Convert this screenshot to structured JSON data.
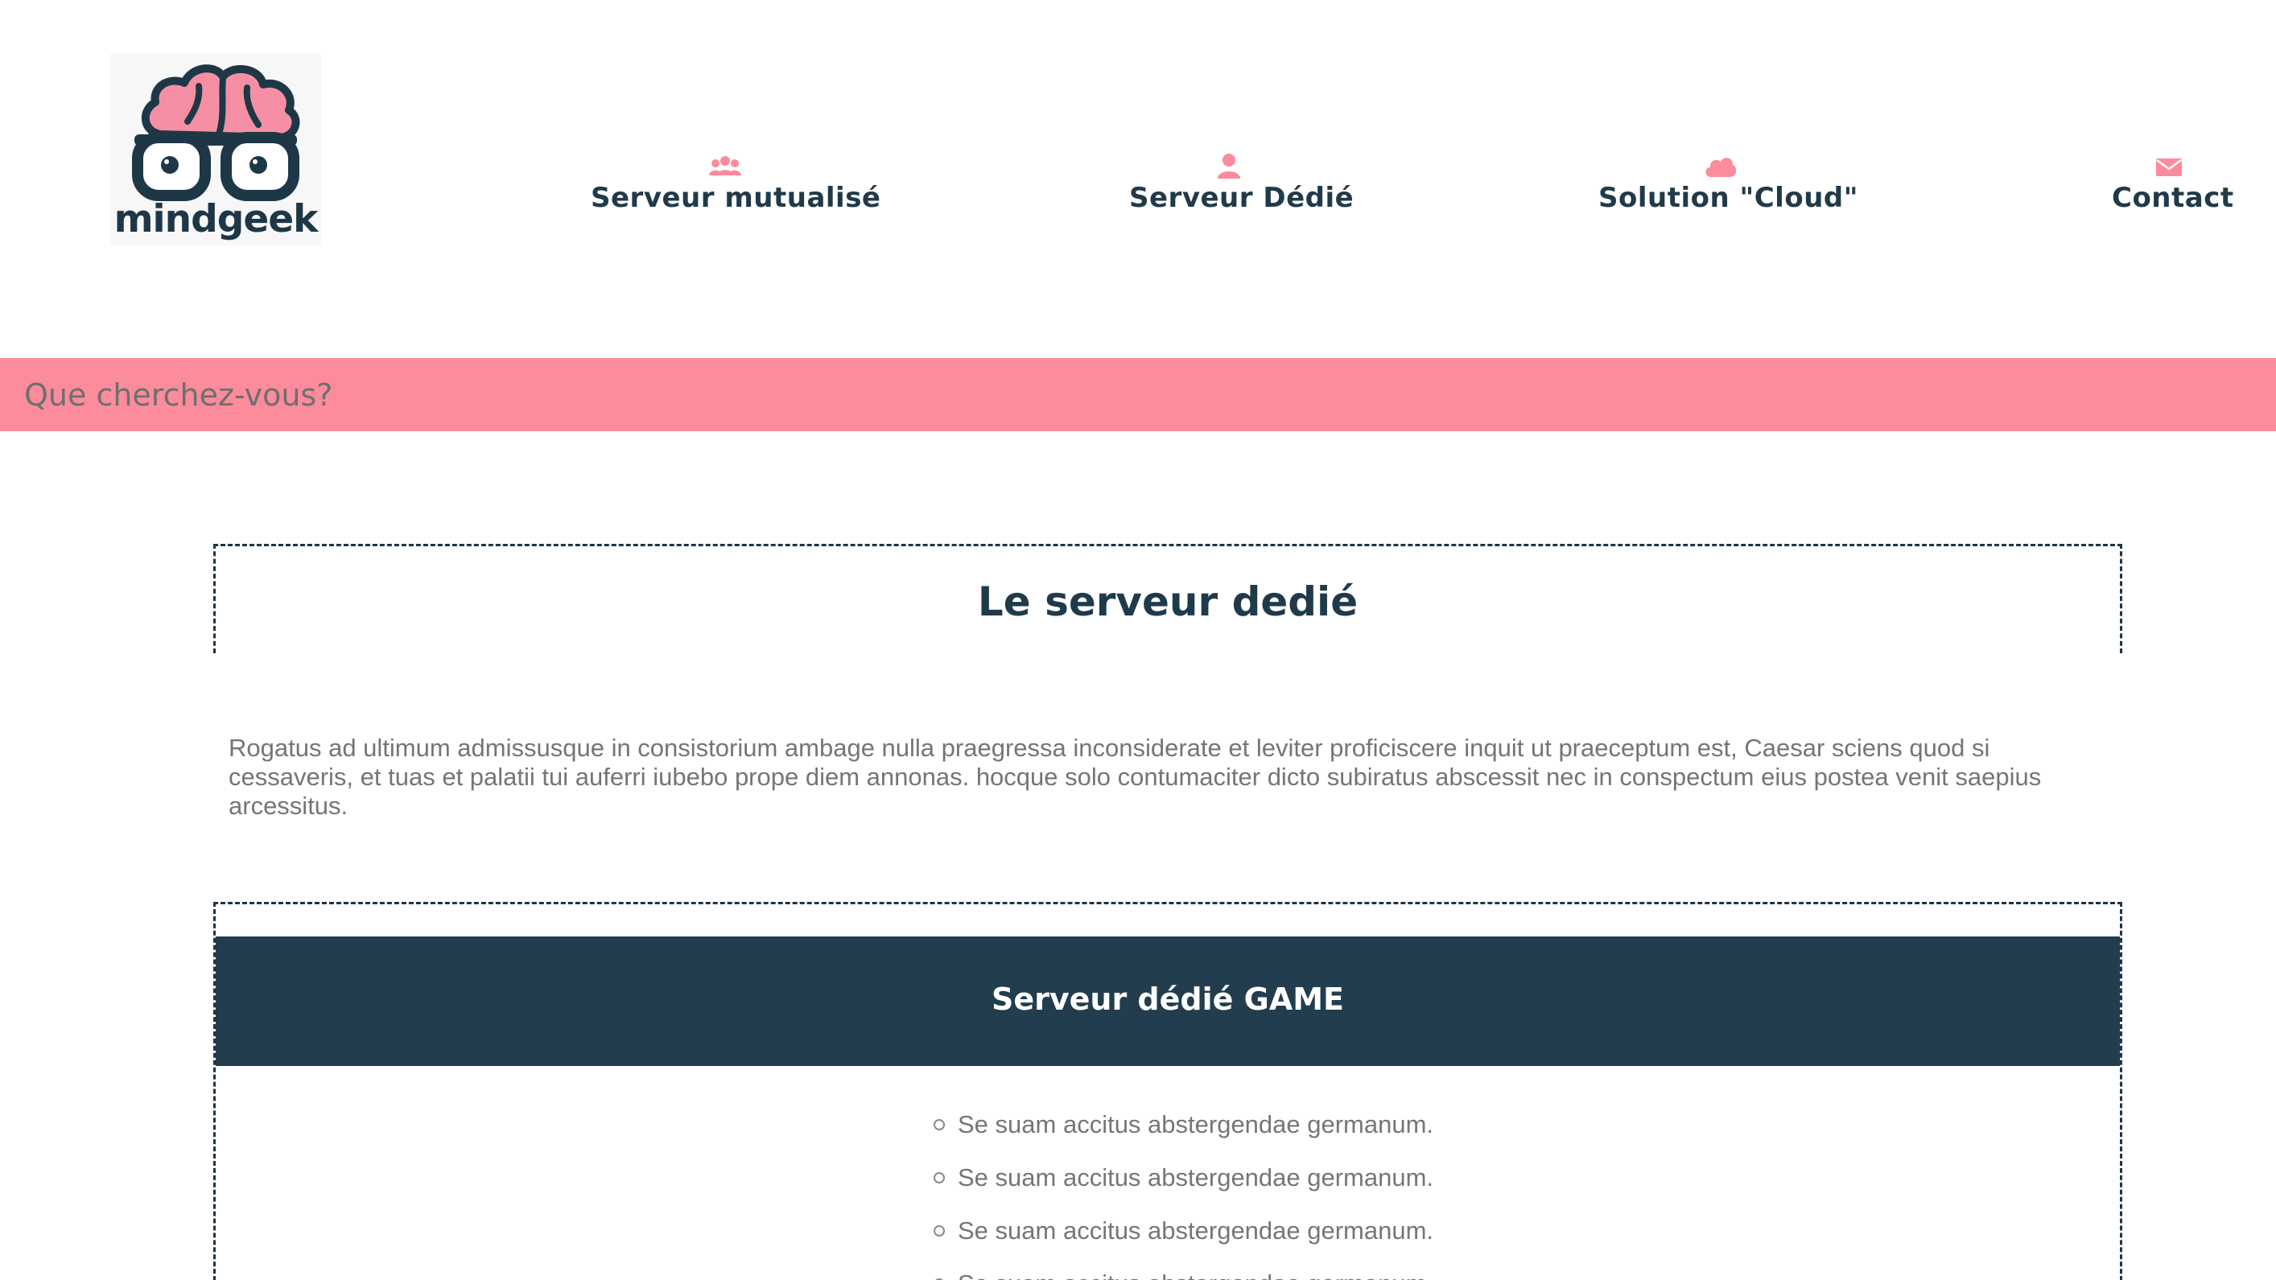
{
  "brand": {
    "name": "mindgeek"
  },
  "colors": {
    "accent_pink": "#fc8b9c",
    "navy": "#223d4d",
    "text_gray": "#757575"
  },
  "nav": {
    "items": [
      {
        "label": "Serveur mutualisé",
        "icon": "users-icon"
      },
      {
        "label": "Serveur Dédié",
        "icon": "user-icon"
      },
      {
        "label": "Solution \"Cloud\"",
        "icon": "cloud-icon"
      },
      {
        "label": "Contact",
        "icon": "envelope-icon"
      }
    ]
  },
  "search": {
    "placeholder": "Que cherchez-vous?",
    "value": ""
  },
  "main": {
    "title": "Le serveur dedié",
    "intro": "Rogatus ad ultimum admissusque in consistorium ambage nulla praegressa inconsiderate et leviter proficiscere inquit ut praeceptum est, Caesar sciens quod si cessaveris, et tuas et palatii tui auferri iubebo prope diem annonas. hocque solo contumaciter dicto subiratus abscessit nec in conspectum eius postea venit saepius arcessitus.",
    "offer": {
      "title": "Serveur dédié GAME",
      "features": [
        "Se suam accitus abstergendae germanum.",
        "Se suam accitus abstergendae germanum.",
        "Se suam accitus abstergendae germanum.",
        "Se suam accitus abstergendae germanum."
      ]
    }
  }
}
